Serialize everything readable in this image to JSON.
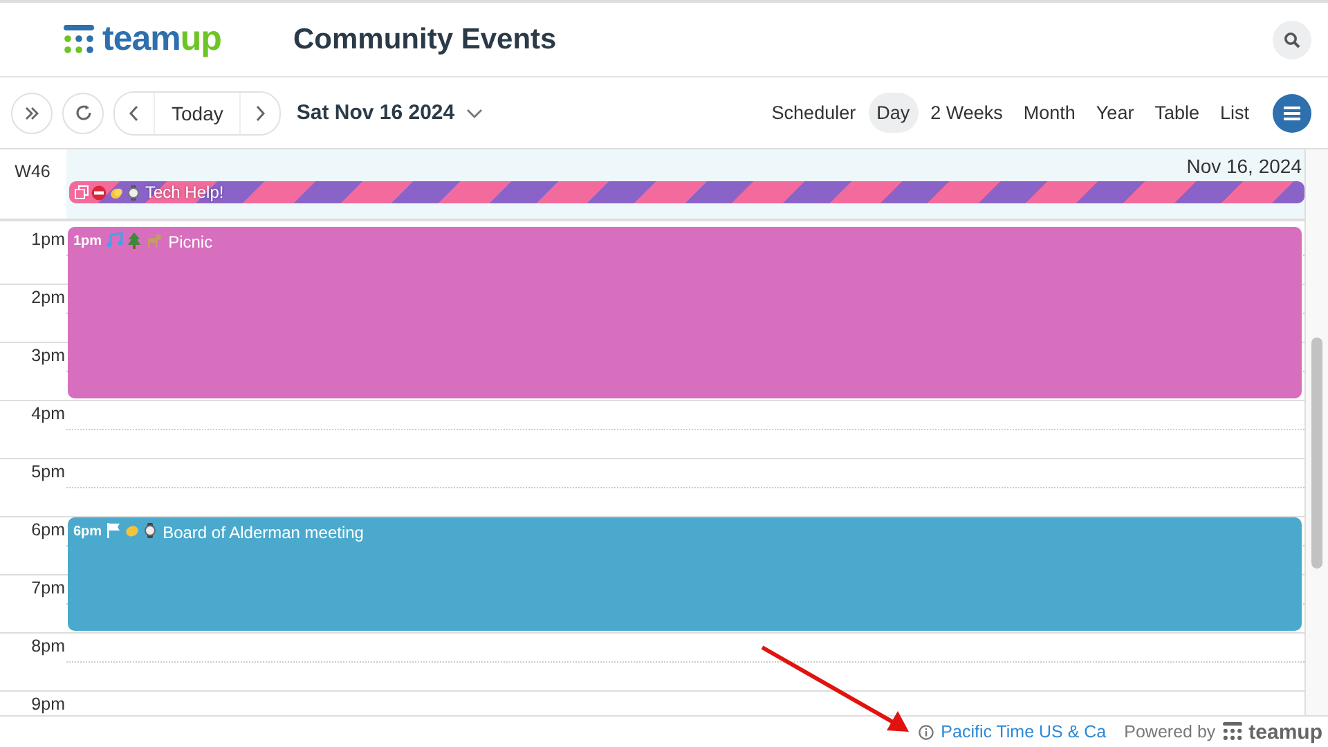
{
  "header": {
    "logo": [
      "team",
      "up"
    ],
    "title": "Community Events"
  },
  "toolbar": {
    "today": "Today",
    "date": "Sat Nov 16 2024",
    "views": [
      {
        "label": "Scheduler",
        "selected": false
      },
      {
        "label": "Day",
        "selected": true
      },
      {
        "label": "2 Weeks",
        "selected": false
      },
      {
        "label": "Month",
        "selected": false
      },
      {
        "label": "Year",
        "selected": false
      },
      {
        "label": "Table",
        "selected": false
      },
      {
        "label": "List",
        "selected": false
      }
    ]
  },
  "all_day": {
    "week": "W46",
    "date": "Nov 16, 2024",
    "event": {
      "title": "Tech Help!"
    }
  },
  "hours": [
    {
      "label": "1pm",
      "event": {
        "time": "1pm",
        "title": "Picnic",
        "color": "#d76ebe"
      }
    },
    {
      "label": "2pm"
    },
    {
      "label": "3pm"
    },
    {
      "label": "4pm"
    },
    {
      "label": "5pm"
    },
    {
      "label": "6pm",
      "event": {
        "time": "6pm",
        "title": "Board of Alderman meeting",
        "color": "#4aa9cd"
      }
    },
    {
      "label": "7pm"
    },
    {
      "label": "8pm"
    },
    {
      "label": "9pm"
    }
  ],
  "footer": {
    "timezone": "Pacific Time US & Ca",
    "powered_by": "Powered by",
    "logo": "teamup"
  }
}
